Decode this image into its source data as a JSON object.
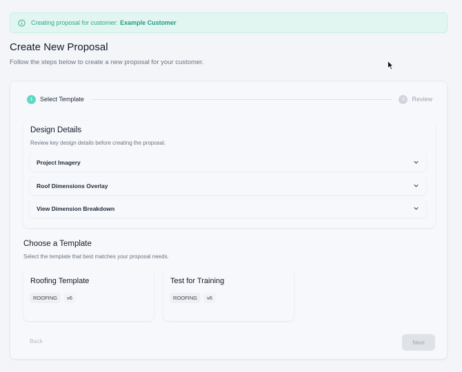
{
  "banner": {
    "prefix": "Creating proposal for customer:",
    "customer": "Example Customer",
    "icon": "info-icon",
    "color": "#2fa58a"
  },
  "header": {
    "title": "Create New Proposal",
    "subtitle": "Follow the steps below to create a new proposal for your customer."
  },
  "stepper": {
    "steps": [
      {
        "number": "1",
        "label": "Select Template",
        "state": "active"
      },
      {
        "number": "2",
        "label": "Review",
        "state": "inactive"
      }
    ],
    "accent": "#5fd9c2"
  },
  "design_details": {
    "title": "Design Details",
    "subtitle": "Review key design details before creating the proposal.",
    "items": [
      {
        "label": "Project Imagery"
      },
      {
        "label": "Roof Dimensions Overlay"
      },
      {
        "label": "View Dimension Breakdown"
      }
    ]
  },
  "templates": {
    "title": "Choose a Template",
    "subtitle": "Select the template that best matches your proposal needs.",
    "cards": [
      {
        "name": "Roofing Template",
        "category": "ROOFING",
        "version": "v6"
      },
      {
        "name": "Test for Training",
        "category": "ROOFING",
        "version": "v6"
      }
    ]
  },
  "footer": {
    "back_label": "Back",
    "next_label": "Next"
  }
}
